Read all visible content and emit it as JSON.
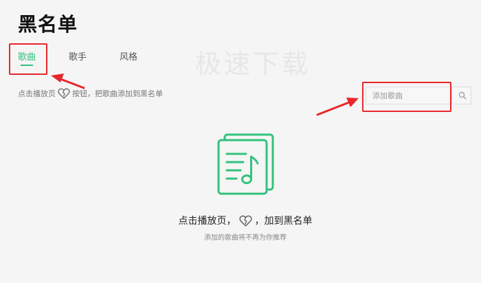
{
  "page": {
    "title": "黑名单",
    "watermark": "极速下载"
  },
  "tabs": [
    {
      "label": "歌曲",
      "active": true
    },
    {
      "label": "歌手",
      "active": false
    },
    {
      "label": "风格",
      "active": false
    }
  ],
  "hint": {
    "prefix": "点击播放页",
    "icon": "broken-heart-icon",
    "suffix": "按钮，把歌曲添加到黑名单"
  },
  "search": {
    "placeholder": "添加歌曲",
    "icon": "search-icon"
  },
  "empty_state": {
    "icon": "music-list-icon",
    "title_prefix": "点击播放页，",
    "title_icon": "broken-heart-icon",
    "title_suffix": "，加到黑名单",
    "subtitle": "添加的歌曲将不再为你推荐"
  },
  "colors": {
    "accent": "#31c27c",
    "annotation": "#e8262b",
    "background": "#f5f5f5"
  }
}
